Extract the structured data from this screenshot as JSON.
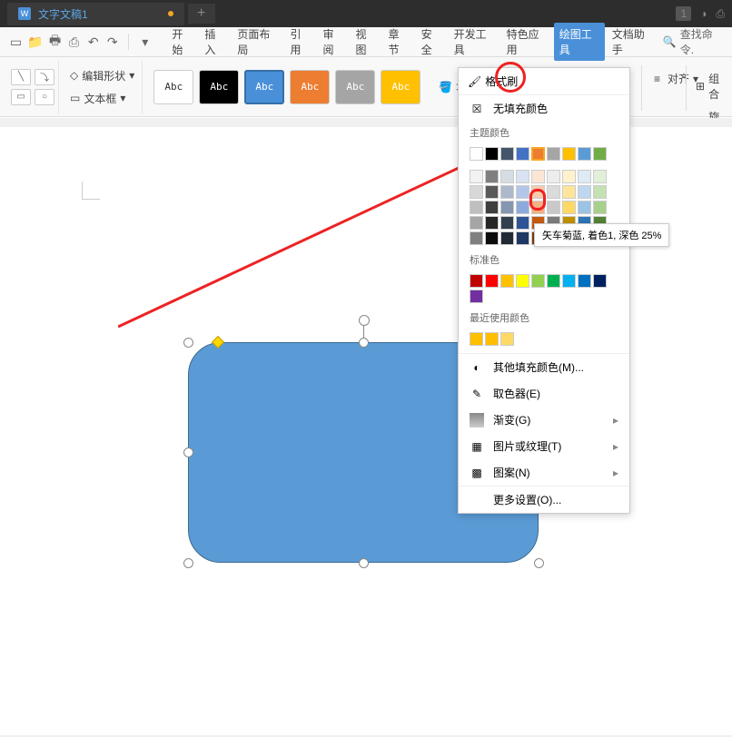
{
  "tab": {
    "title": "文字文稿1",
    "page_indicator": "1"
  },
  "quickbar": {
    "search": "查找命令."
  },
  "menu": [
    "开始",
    "插入",
    "页面布局",
    "引用",
    "审阅",
    "视图",
    "章节",
    "安全",
    "开发工具",
    "特色应用",
    "绘图工具",
    "文档助手"
  ],
  "ribbon": {
    "edit_shape": "编辑形状",
    "text_box": "文本框",
    "styles": [
      "Abc",
      "Abc",
      "Abc",
      "Abc",
      "Abc",
      "Abc"
    ],
    "fill": "填充",
    "format_painter": "格式刷",
    "group": "组合",
    "align": "对齐",
    "rotate": "旋转"
  },
  "popup": {
    "no_fill": "无填充颜色",
    "theme_colors": "主题颜色",
    "theme_row1": [
      "#ffffff",
      "#000000",
      "#44546a",
      "#4472c4",
      "#ed7d31",
      "#a5a5a5",
      "#ffc000",
      "#5b9bd5",
      "#70ad47"
    ],
    "theme_shades": [
      [
        "#f2f2f2",
        "#7f7f7f",
        "#d6dce4",
        "#d9e2f3",
        "#fbe5d5",
        "#ededed",
        "#fff2cc",
        "#deebf6",
        "#e2efd9"
      ],
      [
        "#d8d8d8",
        "#595959",
        "#adb9ca",
        "#b4c6e7",
        "#f7cbac",
        "#dbdbdb",
        "#fee599",
        "#bdd7ee",
        "#c5e0b3"
      ],
      [
        "#bfbfbf",
        "#3f3f3f",
        "#8496b0",
        "#8eaadb",
        "#f4b183",
        "#c9c9c9",
        "#ffd965",
        "#9cc3e5",
        "#a8d08d"
      ],
      [
        "#a5a5a5",
        "#262626",
        "#323f4f",
        "#2f5496",
        "#c55a11",
        "#7b7b7b",
        "#bf9000",
        "#2e75b5",
        "#538135"
      ],
      [
        "#7f7f7f",
        "#0c0c0c",
        "#222a35",
        "#1f3864",
        "#833c0b",
        "#525252",
        "#7f6000",
        "#1e4e79",
        "#375623"
      ]
    ],
    "standard_colors": "标准色",
    "standard_row": [
      "#c00000",
      "#ff0000",
      "#ffc000",
      "#ffff00",
      "#92d050",
      "#00b050",
      "#00b0f0",
      "#0070c0",
      "#002060",
      "#7030a0"
    ],
    "recent_colors": "最近使用颜色",
    "recent_row": [
      "#ffc000",
      "#ffbf00",
      "#ffd966"
    ],
    "more_colors": "其他填充颜色(M)...",
    "eyedropper": "取色器(E)",
    "gradient": "渐变(G)",
    "picture": "图片或纹理(T)",
    "pattern": "图案(N)",
    "more_settings": "更多设置(O)..."
  },
  "tooltip": "矢车菊蓝, 着色1, 深色 25%"
}
